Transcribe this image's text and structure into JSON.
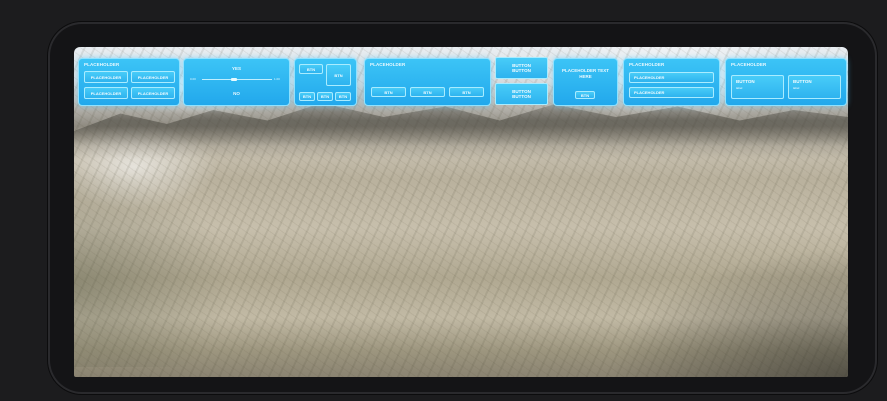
{
  "panel1": {
    "title": "PLACEHOLDER",
    "buttons": [
      "PLACEHOLDER",
      "PLACEHOLDER",
      "PLACEHOLDER",
      "PLACEHOLDER"
    ]
  },
  "panel2": {
    "top_label": "YES",
    "bottom_label": "NO",
    "slider_left": "0.00",
    "slider_right": "1.00",
    "slider_value": 0.45
  },
  "panel3": {
    "buttons": [
      "BTN",
      "BTN",
      "BTN",
      "BTN",
      "BTN"
    ]
  },
  "panel4": {
    "title": "PLACEHOLDER",
    "buttons": [
      "BTN",
      "BTN",
      "BTN"
    ]
  },
  "panel5": {
    "buttons": [
      "BUTTON\nBUTTON",
      "BUTTON\nBUTTON"
    ]
  },
  "panel6": {
    "text": "PLACEHOLDER TEXT\nHERE",
    "button": "BTN"
  },
  "panel7": {
    "title": "PLACEHOLDER",
    "rows": [
      "PLACEHOLDER",
      "PLACEHOLDER"
    ]
  },
  "panel8": {
    "title": "PLACEHOLDER",
    "cells": [
      {
        "label": "BUTTON",
        "sub": "label"
      },
      {
        "label": "BUTTON",
        "sub": "label"
      }
    ]
  }
}
